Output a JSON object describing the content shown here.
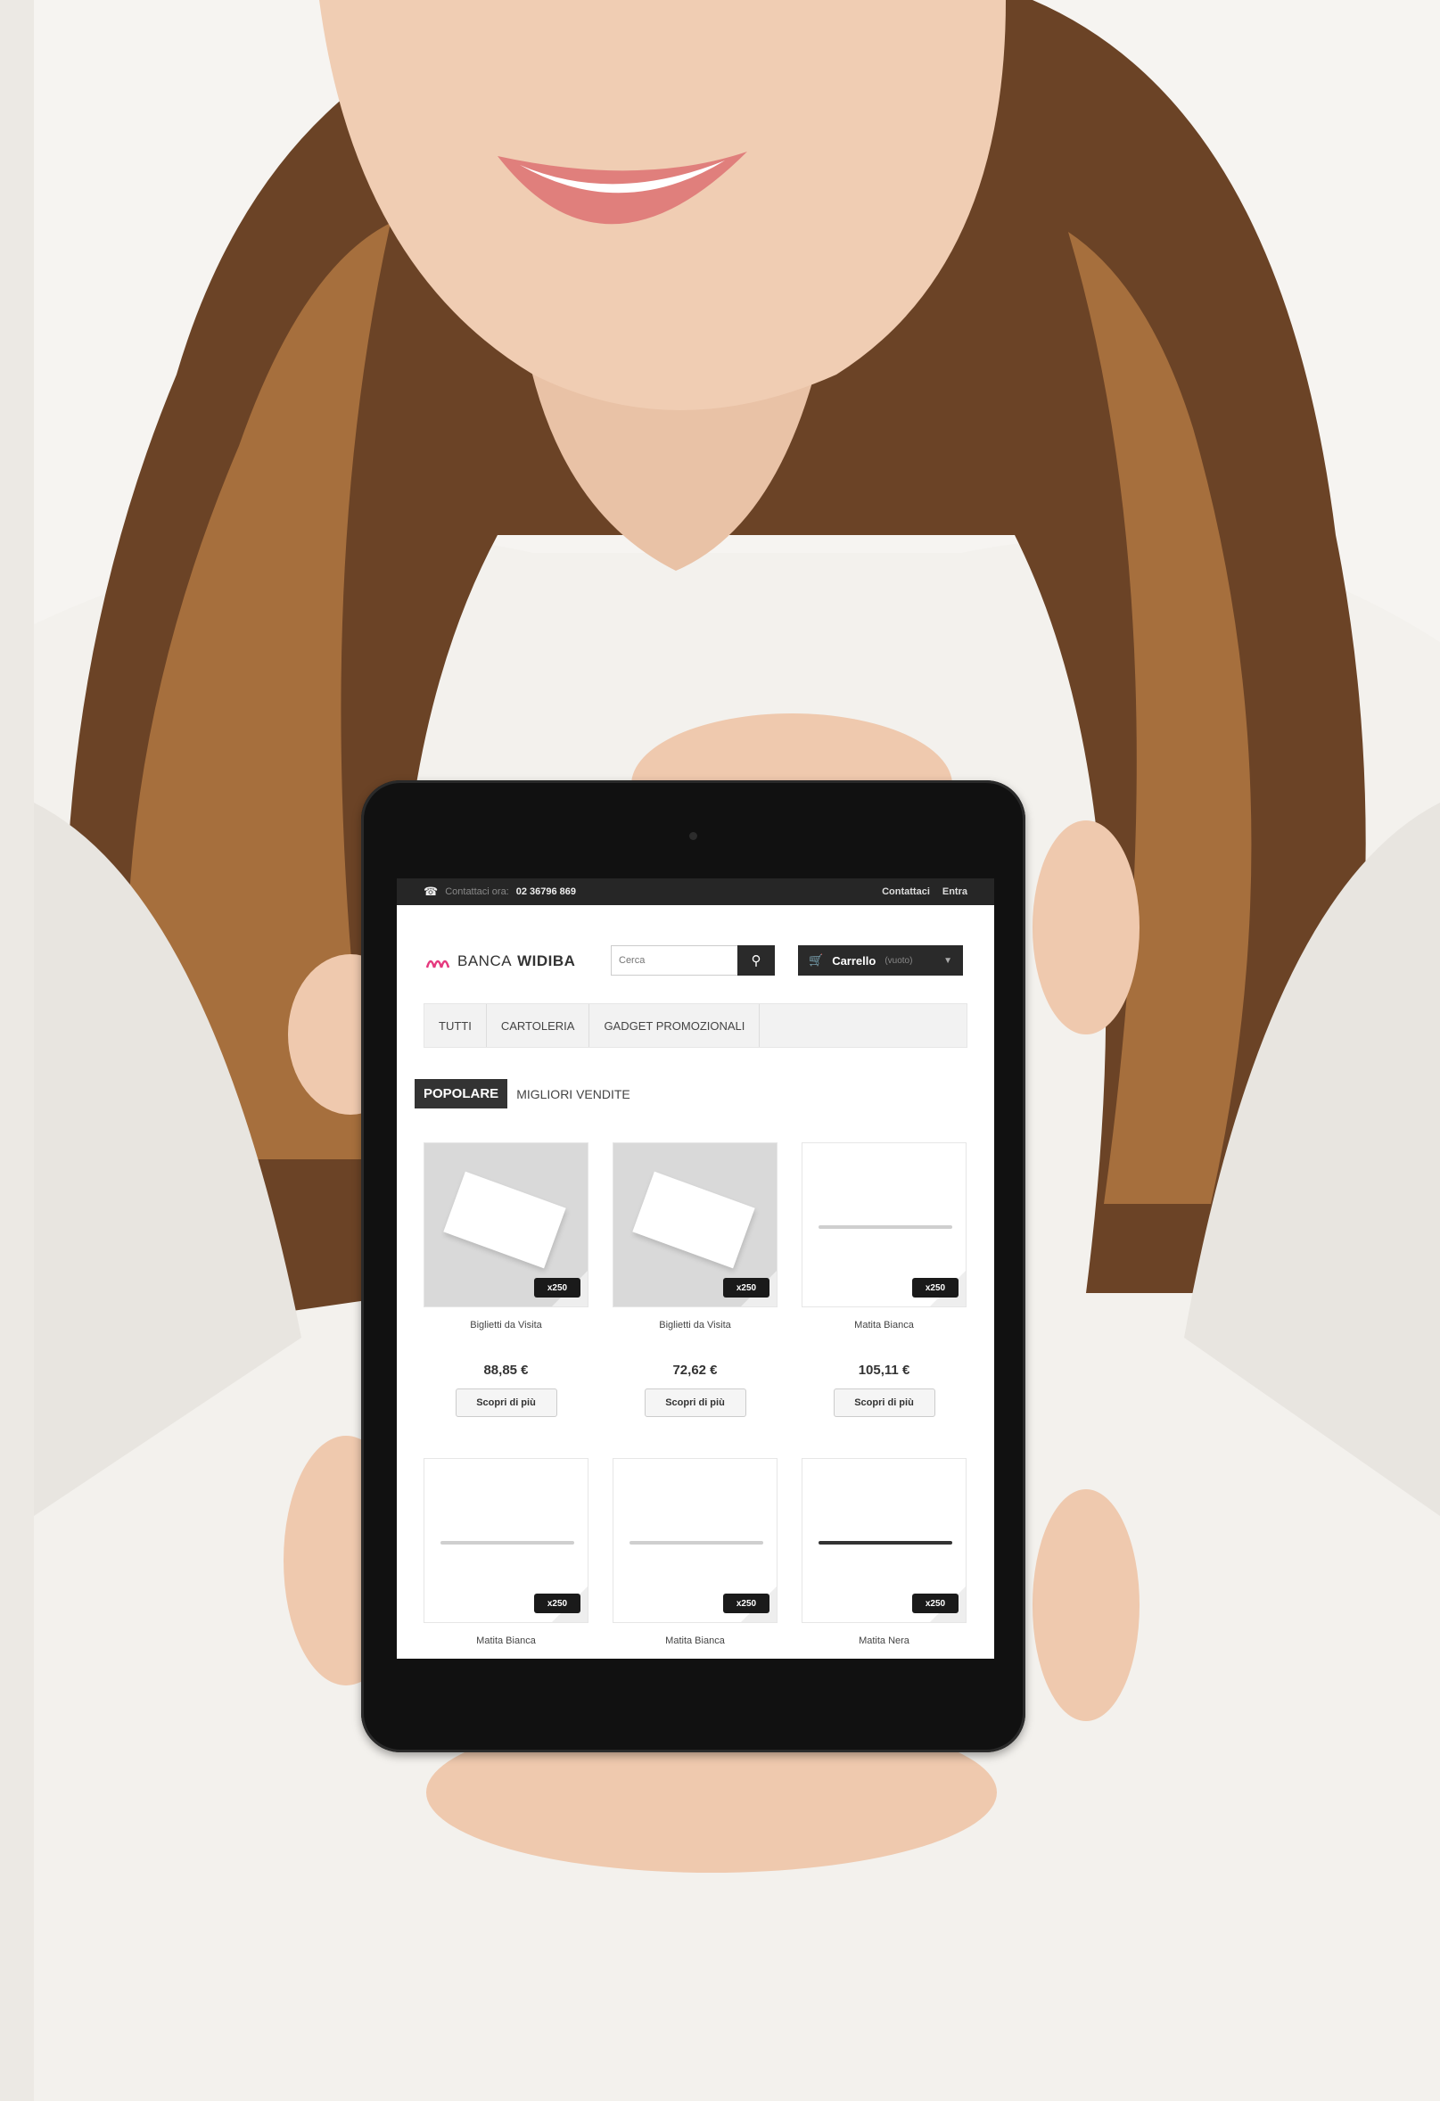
{
  "tablet": {
    "topbar": {
      "phone_icon": "phone-icon",
      "contact_label": "Contattaci ora:",
      "phone_number": "02 36796 869",
      "links": [
        "Contattaci",
        "Entra"
      ]
    },
    "logo": {
      "text_light": "BANCA",
      "text_bold": "WIDIBA",
      "accent": "#e5397e"
    },
    "search": {
      "placeholder": "Cerca",
      "icon": "search-icon"
    },
    "cart": {
      "label": "Carrello",
      "count": "(vuoto)",
      "icon": "cart-icon"
    },
    "nav": [
      "TUTTI",
      "CARTOLERIA",
      "GADGET PROMOZIONALI"
    ],
    "tabs": {
      "active": "POPOLARE",
      "other": "MIGLIORI VENDITE"
    },
    "products": [
      {
        "name": "Biglietti da Visita",
        "price": "88,85 €",
        "button": "Scopri di più",
        "image": "business-card",
        "sticker": "x250"
      },
      {
        "name": "Biglietti da Visita",
        "price": "72,62 €",
        "button": "Scopri di più",
        "image": "business-card",
        "sticker": "x250"
      },
      {
        "name": "Matita Bianca",
        "price": "105,11 €",
        "button": "Scopri di più",
        "image": "white-pencil",
        "sticker": "x250"
      },
      {
        "name": "Matita Bianca",
        "image": "white-pencil",
        "sticker": "x250"
      },
      {
        "name": "Matita Bianca",
        "image": "white-pencil",
        "sticker": "x250"
      },
      {
        "name": "Matita Nera",
        "image": "black-pencil",
        "sticker": "x250"
      }
    ]
  }
}
